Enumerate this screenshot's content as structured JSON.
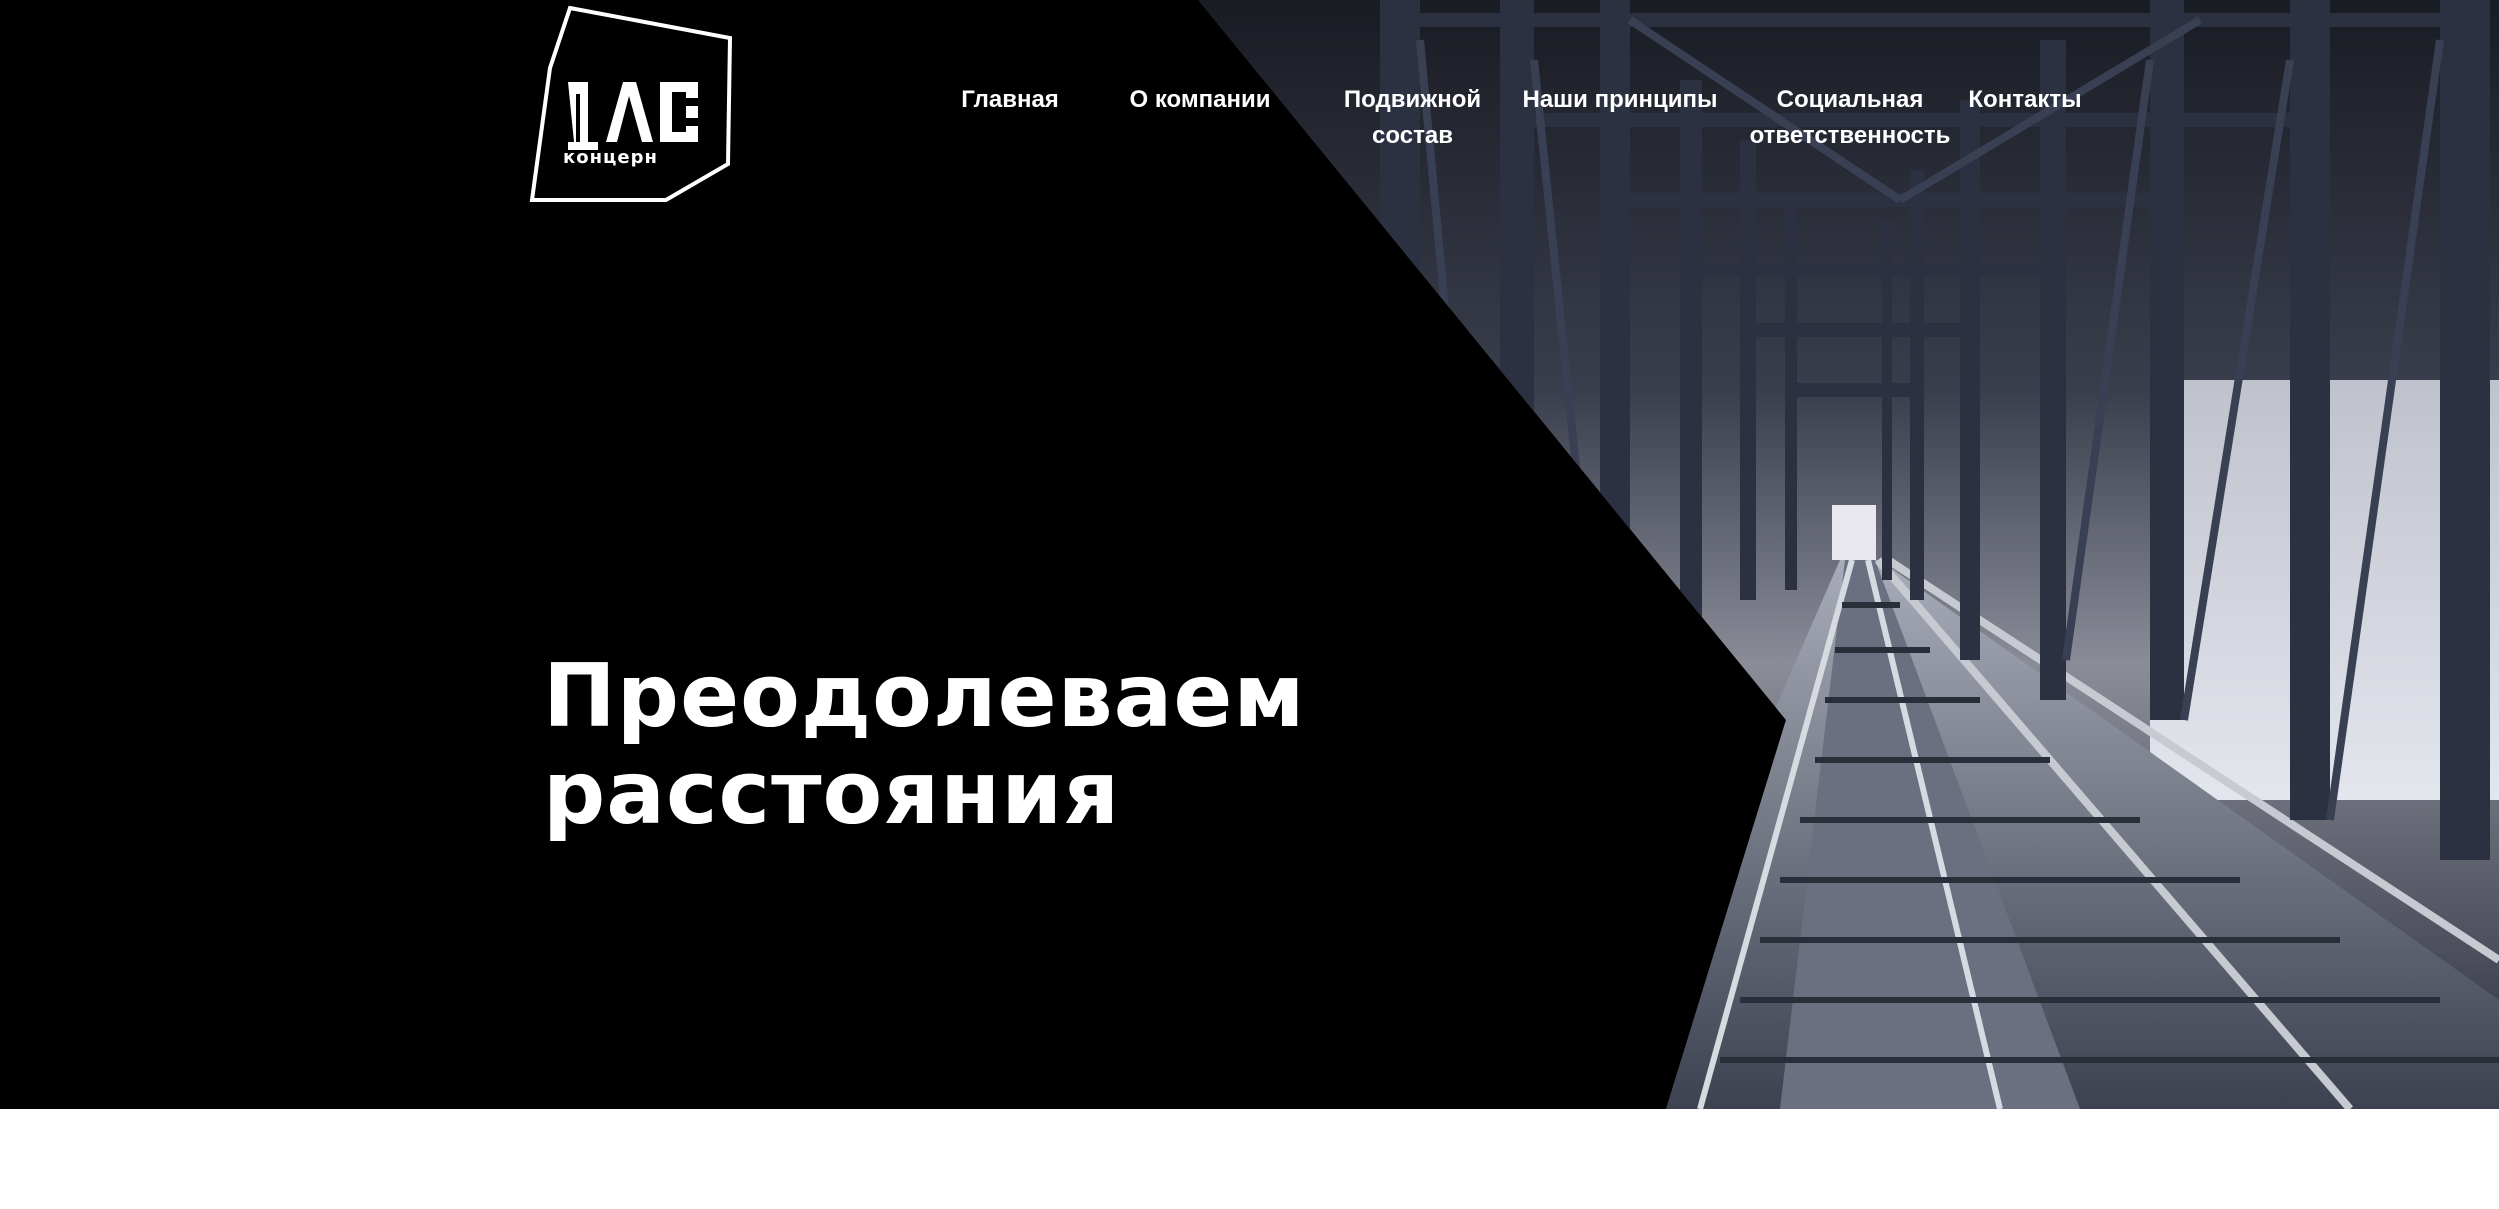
{
  "brand": {
    "logo_mark": "ДЛС",
    "logo_subtitle": "концерн"
  },
  "nav": {
    "items": [
      {
        "label": "Главная"
      },
      {
        "label": "О компании"
      },
      {
        "label": "Подвижной состав"
      },
      {
        "label": "Наши принципы"
      },
      {
        "label": "Социальная ответственность"
      },
      {
        "label": "Контакты"
      }
    ]
  },
  "hero": {
    "headline_line1": "Преодолеваем",
    "headline_line2": "расстояния",
    "background_image": "railway-bridge-photo"
  },
  "colors": {
    "hero_background": "#000000",
    "text": "#ffffff",
    "page_background": "#ffffff"
  }
}
